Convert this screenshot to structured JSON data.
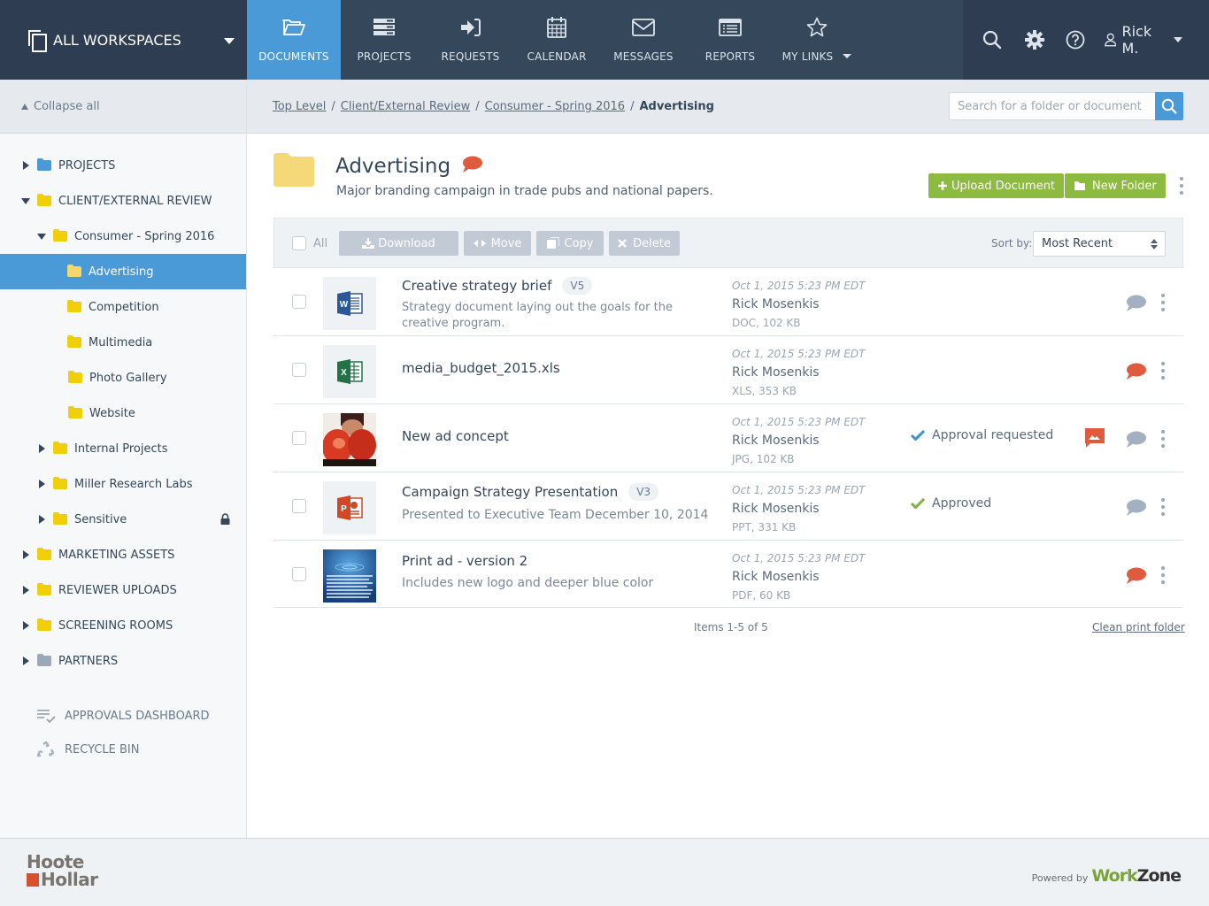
{
  "topbar": {
    "workspace_label": "ALL WORKSPACES",
    "nav": [
      {
        "label": "DOCUMENTS",
        "icon": "folder-open-icon",
        "active": true
      },
      {
        "label": "PROJECTS",
        "icon": "server-stack-icon"
      },
      {
        "label": "REQUESTS",
        "icon": "sign-in-icon"
      },
      {
        "label": "CALENDAR",
        "icon": "calendar-icon"
      },
      {
        "label": "MESSAGES",
        "icon": "envelope-icon"
      },
      {
        "label": "REPORTS",
        "icon": "report-list-icon"
      },
      {
        "label": "MY LINKS",
        "icon": "star-icon",
        "has_dropdown": true
      }
    ],
    "user_name": "Rick M."
  },
  "sidebar": {
    "collapse_label": "Collapse all",
    "tree": [
      {
        "label": "PROJECTS",
        "level": 0,
        "state": "collapsed",
        "folder_color": "blue"
      },
      {
        "label": "CLIENT/EXTERNAL REVIEW",
        "level": 0,
        "state": "expanded",
        "folder_color": "yellow"
      },
      {
        "label": "Consumer - Spring 2016",
        "level": 1,
        "state": "expanded",
        "folder_color": "yellow"
      },
      {
        "label": "Advertising",
        "level": 2,
        "state": "leaf",
        "folder_color": "yellow",
        "selected": true
      },
      {
        "label": "Competition",
        "level": 2,
        "state": "leaf",
        "folder_color": "yellow"
      },
      {
        "label": "Multimedia",
        "level": 2,
        "state": "leaf",
        "folder_color": "yellow"
      },
      {
        "label": "Photo Gallery",
        "level": 2,
        "state": "leaf",
        "folder_color": "yellow"
      },
      {
        "label": "Website",
        "level": 2,
        "state": "leaf",
        "folder_color": "yellow"
      },
      {
        "label": "Internal Projects",
        "level": 1,
        "state": "collapsed",
        "folder_color": "yellow"
      },
      {
        "label": "Miller Research Labs",
        "level": 1,
        "state": "collapsed",
        "folder_color": "yellow"
      },
      {
        "label": "Sensitive",
        "level": 1,
        "state": "collapsed",
        "folder_color": "yellow",
        "locked": true
      },
      {
        "label": "MARKETING ASSETS",
        "level": 0,
        "state": "collapsed",
        "folder_color": "yellow"
      },
      {
        "label": "REVIEWER UPLOADS",
        "level": 0,
        "state": "collapsed",
        "folder_color": "yellow"
      },
      {
        "label": "SCREENING ROOMS",
        "level": 0,
        "state": "collapsed",
        "folder_color": "yellow"
      },
      {
        "label": "PARTNERS",
        "level": 0,
        "state": "collapsed",
        "folder_color": "gray"
      }
    ],
    "links": [
      {
        "label": "APPROVALS DASHBOARD",
        "icon": "approvals-list-icon"
      },
      {
        "label": "RECYCLE BIN",
        "icon": "recycle-icon"
      }
    ]
  },
  "breadcrumb": {
    "items": [
      "Top Level",
      "Client/External Review",
      "Consumer - Spring 2016"
    ],
    "current": "Advertising",
    "separator": "/"
  },
  "search": {
    "placeholder": "Search for a folder or document",
    "value": ""
  },
  "folder": {
    "title": "Advertising",
    "description": "Major branding campaign in trade pubs and national papers.",
    "has_comments": true,
    "upload_label": "Upload Document",
    "new_folder_label": "New Folder"
  },
  "toolbar": {
    "select_all_label": "All",
    "download_label": "Download",
    "move_label": "Move",
    "copy_label": "Copy",
    "delete_label": "Delete",
    "sort_label": "Sort by:",
    "sort_value": "Most Recent"
  },
  "documents": [
    {
      "name": "Creative strategy brief",
      "version": "V5",
      "description": "Strategy document laying out the goals for the creative program.",
      "type": "word",
      "date": "Oct 1, 2015 5:23 PM EDT",
      "author": "Rick Mosenkis",
      "size": "DOC, 102 KB",
      "status": "",
      "comment_state": "none"
    },
    {
      "name": "media_budget_2015.xls",
      "version": "",
      "description": "",
      "type": "excel",
      "date": "Oct 1, 2015 5:23 PM EDT",
      "author": "Rick Mosenkis",
      "size": "XLS, 353 KB",
      "status": "",
      "comment_state": "new"
    },
    {
      "name": "New ad concept",
      "version": "",
      "description": "",
      "type": "image-boxer",
      "date": "Oct 1, 2015 5:23 PM EDT",
      "author": "Rick Mosenkis",
      "size": "JPG, 102 KB",
      "status": "Approval requested",
      "status_color": "#3a94d8",
      "has_annotation": true,
      "comment_state": "none"
    },
    {
      "name": "Campaign Strategy Presentation",
      "version": "V3",
      "description": "Presented to Executive Team December 10, 2014",
      "type": "powerpoint",
      "date": "Oct 1, 2015 5:23 PM EDT",
      "author": "Rick Mosenkis",
      "size": "PPT, 331 KB",
      "status": "Approved",
      "status_color": "#7cb342",
      "comment_state": "none"
    },
    {
      "name": "Print ad - version 2",
      "version": "",
      "description": "Includes new logo and deeper blue color",
      "type": "image-print-ad",
      "date": "Oct 1, 2015 5:23 PM EDT",
      "author": "Rick Mosenkis",
      "size": "PDF, 60 KB",
      "status": "",
      "comment_state": "new"
    }
  ],
  "pager": {
    "label": "Items 1-5 of 5"
  },
  "clean_print_label": "Clean print folder",
  "footer": {
    "logo_line1": "Hoote",
    "logo_line2": "Hollar",
    "powered_by": "Powered by",
    "brand_work": "Work",
    "brand_zone": "Zone"
  },
  "colors": {
    "accent": "#4a9ad8",
    "nav_bg": "#2f3d52",
    "green": "#8dbb3f",
    "comment_new": "#e05a3e",
    "comment_none": "#a3b0c2"
  }
}
